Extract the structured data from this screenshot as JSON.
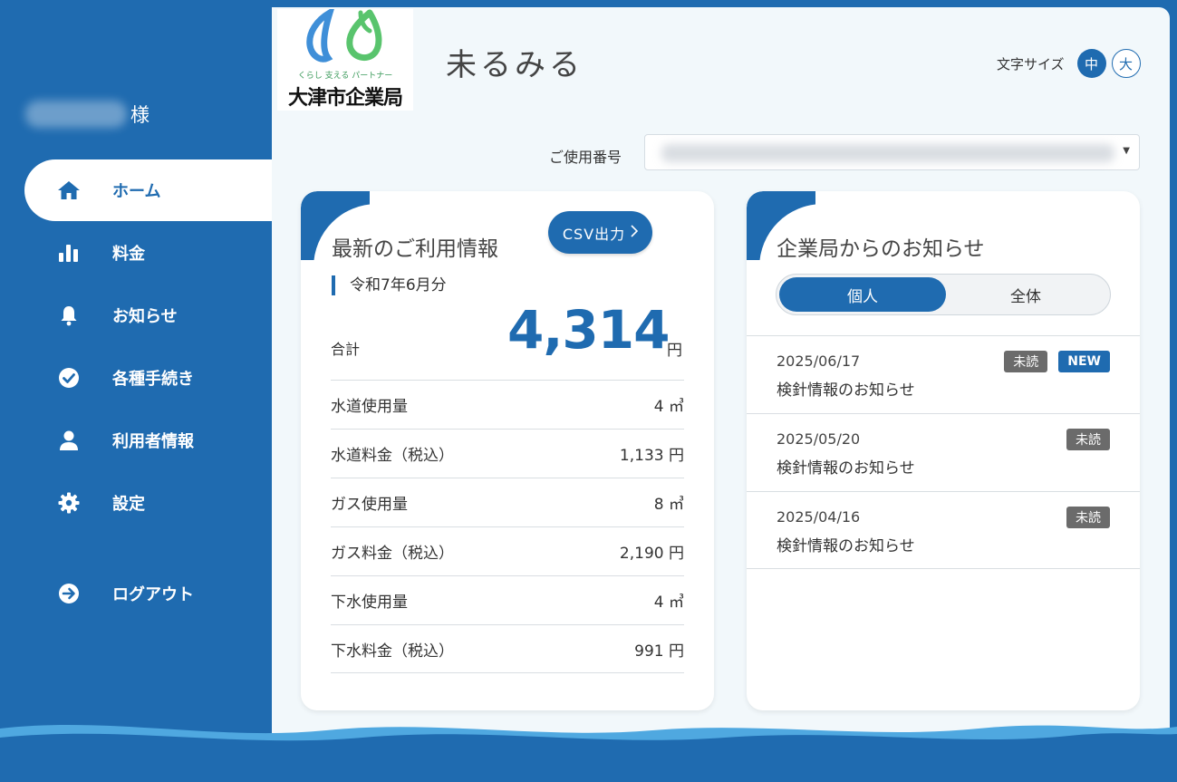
{
  "user": {
    "suffix": "様"
  },
  "app": {
    "title": "未るみる"
  },
  "logo": {
    "caption": "くらし 支える パートナー",
    "name": "大津市企業局"
  },
  "font_size": {
    "label": "文字サイズ",
    "medium": "中",
    "large": "大"
  },
  "usage_number": {
    "label": "ご使用番号"
  },
  "nav": [
    {
      "label": "ホーム",
      "icon": "home-icon",
      "active": true
    },
    {
      "label": "料金",
      "icon": "bar-chart-icon",
      "active": false
    },
    {
      "label": "お知らせ",
      "icon": "bell-icon",
      "active": false
    },
    {
      "label": "各種手続き",
      "icon": "check-circle-icon",
      "active": false
    },
    {
      "label": "利用者情報",
      "icon": "user-icon",
      "active": false
    },
    {
      "label": "設定",
      "icon": "gear-icon",
      "active": false
    }
  ],
  "logout": {
    "label": "ログアウト",
    "icon": "logout-arrow-icon"
  },
  "usage": {
    "title": "最新のご利用情報",
    "csv_label": "CSV出力",
    "period": "令和7年6月分",
    "total_label": "合計",
    "total_value": "4,314",
    "total_unit": "円",
    "rows": [
      {
        "label": "水道使用量",
        "value": "4 ㎥"
      },
      {
        "label": "水道料金（税込）",
        "value": "1,133 円"
      },
      {
        "label": "ガス使用量",
        "value": "8 ㎥"
      },
      {
        "label": "ガス料金（税込）",
        "value": "2,190 円"
      },
      {
        "label": "下水使用量",
        "value": "4 ㎥"
      },
      {
        "label": "下水料金（税込）",
        "value": "991 円"
      }
    ]
  },
  "news": {
    "title": "企業局からのお知らせ",
    "tabs": [
      {
        "label": "個人",
        "active": true
      },
      {
        "label": "全体",
        "active": false
      }
    ],
    "unread_label": "未読",
    "new_label": "NEW",
    "items": [
      {
        "date": "2025/06/17",
        "title": "検針情報のお知らせ",
        "unread": true,
        "new": true
      },
      {
        "date": "2025/05/20",
        "title": "検針情報のお知らせ",
        "unread": true,
        "new": false
      },
      {
        "date": "2025/04/16",
        "title": "検針情報のお知らせ",
        "unread": true,
        "new": false
      }
    ]
  },
  "colors": {
    "primary": "#1f6bb0",
    "background": "#f2f8fb",
    "unread_badge": "#6b6b6b"
  }
}
